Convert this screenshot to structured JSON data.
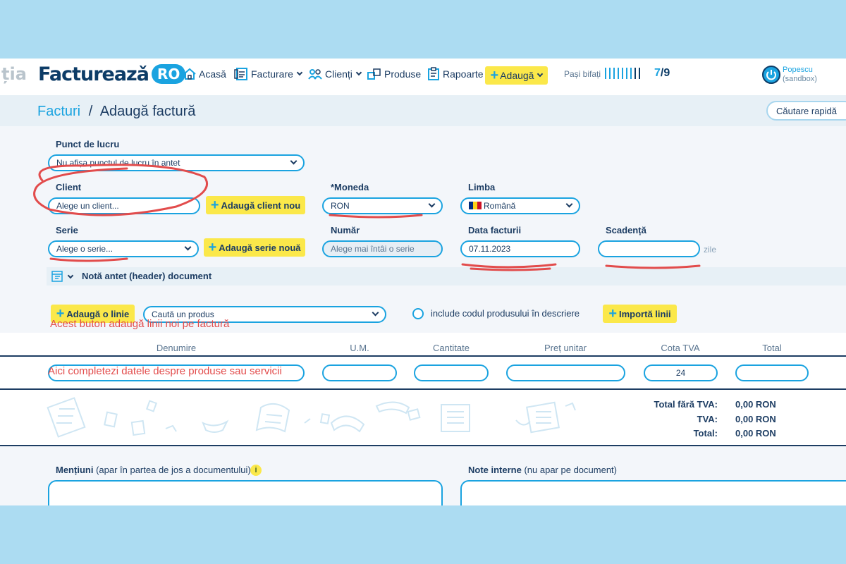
{
  "nav": {
    "ghost_text": "ția",
    "logo_main": "Factureazǎ",
    "logo_ro": "RO",
    "items": [
      {
        "label": "Acasă",
        "icon": "home-icon"
      },
      {
        "label": "Facturare",
        "icon": "invoice-icon"
      },
      {
        "label": "Clienți",
        "icon": "clients-icon"
      },
      {
        "label": "Produse",
        "icon": "products-icon"
      },
      {
        "label": "Rapoarte",
        "icon": "reports-icon"
      }
    ],
    "add_label": "Adaugă",
    "steps_label": "Pași bifați",
    "steps_done": "7",
    "steps_total": "/9",
    "steps_progress": 0.78,
    "user_name": "Popescu",
    "user_sub": "(sandbox)"
  },
  "breadcrumb": {
    "root": "Facturi",
    "sep": "/",
    "current": "Adaugă factură"
  },
  "quick_search_label": "Căutare rapidă",
  "form": {
    "punct_label": "Punct de lucru",
    "punct_value": "Nu afișa punctul de lucru în antet",
    "client_label": "Client",
    "client_placeholder": "Alege un client...",
    "add_client": "Adaugă client nou",
    "moneda_label": "*Moneda",
    "moneda_value": "RON",
    "limba_label": "Limba",
    "limba_value": "Română",
    "serie_label": "Serie",
    "serie_placeholder": "Alege o serie...",
    "add_serie": "Adaugă serie nouă",
    "numar_label": "Număr",
    "numar_placeholder": "Alege mai întâi o serie",
    "data_label": "Data facturii",
    "data_value": "07.11.2023",
    "scadenta_label": "Scadență",
    "scadenta_value": "",
    "zile": "zile",
    "header_note": "Notă antet (header) document"
  },
  "lines": {
    "add_line": "Adaugă o linie",
    "search_product": "Caută un produs",
    "include_code": "include codul produsului în descriere",
    "import": "Importă linii",
    "annotation_button": "Acest buton adaugă linii noi pe factură",
    "annotation_row": "Aici completezi datele despre produse sau servicii",
    "columns": [
      "Denumire",
      "U.M.",
      "Cantitate",
      "Preț unitar",
      "Cota TVA",
      "Total"
    ],
    "cota_tva": "24"
  },
  "totals": {
    "fara_tva_label": "Total fără TVA:",
    "fara_tva_value": "0,00 RON",
    "tva_label": "TVA:",
    "tva_value": "0,00 RON",
    "total_label": "Total:",
    "total_value": "0,00 RON"
  },
  "bottom": {
    "mentiuni_label": "Mențiuni",
    "mentiuni_sub": "(apar în partea de jos a documentului)",
    "info": "i",
    "note_label": "Note interne",
    "note_sub": "(nu apar pe document)"
  },
  "colors": {
    "accent": "#1aa3e0",
    "navy": "#1d3d63",
    "highlight": "#fbe84a",
    "annotation": "#e24c4c",
    "backdrop": "#acdcf2"
  }
}
